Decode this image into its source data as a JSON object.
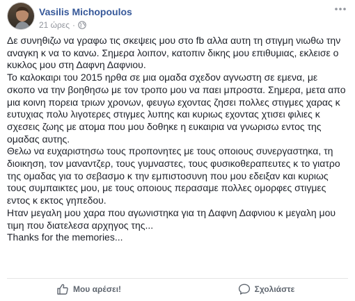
{
  "post": {
    "author": "Vasilis Michopoulos",
    "time": "21 ώρες",
    "separator": "·",
    "audience_icon": "globe-icon",
    "lines": [
      "Δε συνηθιζω να γραφω τις σκεψεις μου στο fb αλλα αυτη τη στιγμη νιωθω την",
      "αναγκη κ να το κανω. Σημερα λοιπον, κατοπιν δικης μου επιθυμιας, εκλεισε ο",
      "κυκλος μου στη Δαφνη Δαφνιου.",
      "Το καλοκαιρι του 2015 ηρθα σε μια ομαδα σχεδον αγνωστη σε εμενα, με",
      "σκοπο να την βοηθησω με τον τροπο μου να παει μπροστα. Σημερα, μετα απο",
      "μια κοινη πορεια τριων χρονων, φευγω εχοντας ζησει πολλες στιγμες χαρας κ",
      "ευτυχιας πολυ λιγοτερες στιγμες λυπης και κυριως εχοντας χτισει φιλιες κ",
      "σχεσεις ζωης με ατομα που μου δοθηκε η ευκαιρια να γνωρισω εντος της",
      "ομαδας αυτης.",
      "Θελω να ευχαριστησω τους προπονητες με τους οποιους συνεργαστηκα, τη",
      "διοικηση, τον μαναντζερ, τους γυμναστες, τους φυσικοθεραπευτες κ το γιατρο",
      "της ομαδας για το σεβασμο κ την εμπιστοσυνη που μου εδειξαν και κυριως",
      "τους συμπαικτες μου, με τους οποιους περασαμε πολλες ομορφες στιγμες",
      "εντος κ εκτος γηπεδου.",
      "Ηταν μεγαλη μου χαρα που αγωνιστηκα για τη Δαφνη Δαφνιου κ μεγαλη μου",
      "τιμη που διατελεσα αρχηγος της...",
      "Thanks for the memories..."
    ]
  },
  "actions": {
    "like_label": "Μου αρέσει!",
    "comment_label": "Σχολιάστε"
  },
  "colors": {
    "author_link": "#365899",
    "meta_text": "#90949c",
    "body_text": "#1d2129",
    "action_text": "#606770"
  }
}
